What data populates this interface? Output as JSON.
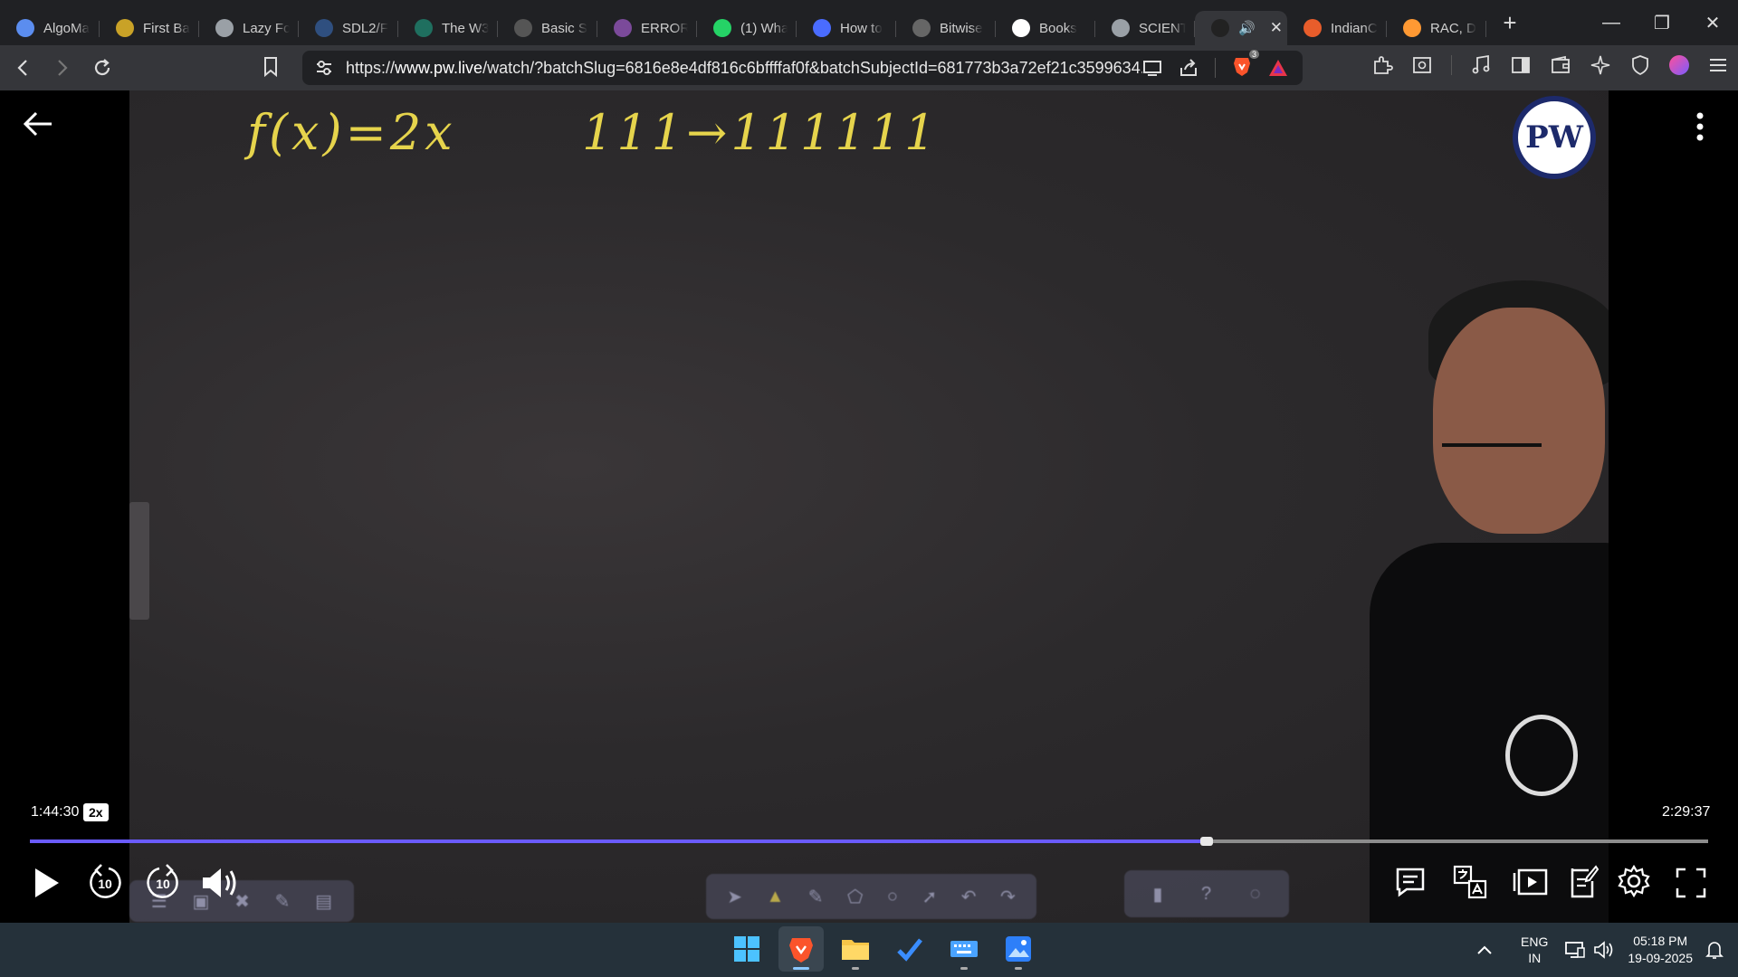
{
  "browser": {
    "tabs": [
      {
        "label": "AlgoMa",
        "icon": "algomaster-icon",
        "color": "#5b8def"
      },
      {
        "label": "First Ba",
        "icon": "coin-icon",
        "color": "#c9a227"
      },
      {
        "label": "Lazy Fo",
        "icon": "globe-icon",
        "color": "#9aa0a6"
      },
      {
        "label": "SDL2/F",
        "icon": "sdl-icon",
        "color": "#2f4f7f"
      },
      {
        "label": "The W3",
        "icon": "w3schools-icon",
        "color": "#1f6f5f"
      },
      {
        "label": "Basic S",
        "icon": "gfg-icon",
        "color": "#555"
      },
      {
        "label": "ERROR",
        "icon": "error-site-icon",
        "color": "#7b4a9a"
      },
      {
        "label": "(1) Wha",
        "icon": "whatsapp-icon",
        "color": "#25d366"
      },
      {
        "label": "How to",
        "icon": "bookmark-blue-icon",
        "color": "#4a6cff"
      },
      {
        "label": "Bitwise",
        "icon": "oracle-icon",
        "color": "#666"
      },
      {
        "label": "Books",
        "icon": "google-icon",
        "color": "#ffffff"
      },
      {
        "label": "SCIENT",
        "icon": "globe-icon",
        "color": "#9aa0a6"
      },
      {
        "label": "",
        "icon": "pw-tab-icon",
        "color": "#222",
        "active": true
      },
      {
        "label": "IndianC",
        "icon": "indianc-icon",
        "color": "#e85d2b"
      },
      {
        "label": "RAC, D",
        "icon": "india-flag-icon",
        "color": "#ff9933"
      }
    ],
    "url_prefix": "https://",
    "url_domain": "www.pw.live",
    "url_rest": "/watch/?batchSlug=6816e8e4df816c6bffffaf0f&batchSubjectId=681773b3a72ef21c3599634...",
    "brave_badge": "3"
  },
  "board": {
    "formula": "f(x)=2x",
    "mapping": "111→111111"
  },
  "logo": {
    "text": "PW"
  },
  "player": {
    "current_time": "1:44:30",
    "speed": "2x",
    "total_time": "2:29:37",
    "progress_fraction": 0.6987,
    "rewind_label": "10",
    "forward_label": "10"
  },
  "taskbar": {
    "lang_line1": "ENG",
    "lang_line2": "IN",
    "time": "05:18 PM",
    "date": "19-09-2025"
  },
  "colors": {
    "accent": "#6a5bff",
    "chalk": "#e6d44c"
  }
}
